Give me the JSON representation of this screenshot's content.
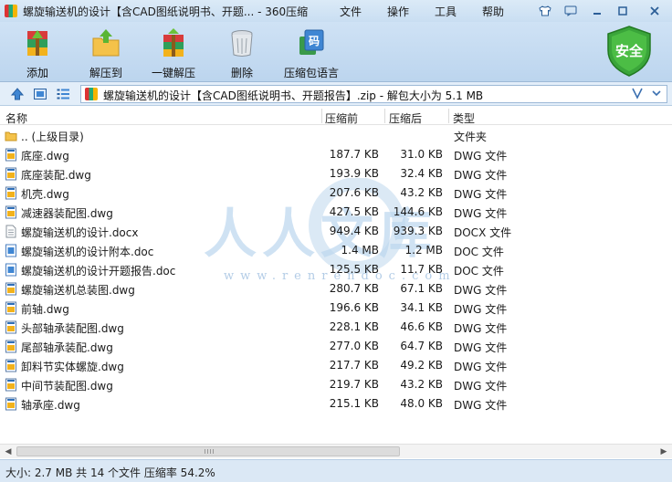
{
  "window": {
    "title": "螺旋输送机的设计【含CAD图纸说明书、开题... - 360压缩",
    "menus": [
      "文件",
      "操作",
      "工具",
      "帮助"
    ]
  },
  "toolbar": {
    "add": "添加",
    "extract_to": "解压到",
    "one_click_extract": "一键解压",
    "delete": "删除",
    "comment": "压缩包语言"
  },
  "security": {
    "label": "安全"
  },
  "address": {
    "path": "螺旋输送机的设计【含CAD图纸说明书、开题报告】.zip - 解包大小为 5.1 MB"
  },
  "columns": {
    "name": "名称",
    "packed": "压缩前",
    "size": "压缩后",
    "type": "类型"
  },
  "files": [
    {
      "name": ".. (上级目录)",
      "packed": "",
      "size": "",
      "type": "文件夹",
      "icon": "folder"
    },
    {
      "name": "底座.dwg",
      "packed": "187.7 KB",
      "size": "31.0 KB",
      "type": "DWG 文件",
      "icon": "dwg"
    },
    {
      "name": "底座装配.dwg",
      "packed": "193.9 KB",
      "size": "32.4 KB",
      "type": "DWG 文件",
      "icon": "dwg"
    },
    {
      "name": "机壳.dwg",
      "packed": "207.6 KB",
      "size": "43.2 KB",
      "type": "DWG 文件",
      "icon": "dwg"
    },
    {
      "name": "减速器装配图.dwg",
      "packed": "427.5 KB",
      "size": "144.6 KB",
      "type": "DWG 文件",
      "icon": "dwg"
    },
    {
      "name": "螺旋输送机的设计.docx",
      "packed": "949.4 KB",
      "size": "939.3 KB",
      "type": "DOCX 文件",
      "icon": "docx"
    },
    {
      "name": "螺旋输送机的设计附本.doc",
      "packed": "1.4 MB",
      "size": "1.2 MB",
      "type": "DOC 文件",
      "icon": "doc"
    },
    {
      "name": "螺旋输送机的设计开题报告.doc",
      "packed": "125.5 KB",
      "size": "11.7 KB",
      "type": "DOC 文件",
      "icon": "doc"
    },
    {
      "name": "螺旋输送机总装图.dwg",
      "packed": "280.7 KB",
      "size": "67.1 KB",
      "type": "DWG 文件",
      "icon": "dwg"
    },
    {
      "name": "前轴.dwg",
      "packed": "196.6 KB",
      "size": "34.1 KB",
      "type": "DWG 文件",
      "icon": "dwg"
    },
    {
      "name": "头部轴承装配图.dwg",
      "packed": "228.1 KB",
      "size": "46.6 KB",
      "type": "DWG 文件",
      "icon": "dwg"
    },
    {
      "name": "尾部轴承装配.dwg",
      "packed": "277.0 KB",
      "size": "64.7 KB",
      "type": "DWG 文件",
      "icon": "dwg"
    },
    {
      "name": "卸料节实体螺旋.dwg",
      "packed": "217.7 KB",
      "size": "49.2 KB",
      "type": "DWG 文件",
      "icon": "dwg"
    },
    {
      "name": "中间节装配图.dwg",
      "packed": "219.7 KB",
      "size": "43.2 KB",
      "type": "DWG 文件",
      "icon": "dwg"
    },
    {
      "name": "轴承座.dwg",
      "packed": "215.1 KB",
      "size": "48.0 KB",
      "type": "DWG 文件",
      "icon": "dwg"
    }
  ],
  "watermark": {
    "text": "人人文库",
    "url": "www.renrendoc.com"
  },
  "status": {
    "text": "大小: 2.7 MB 共 14 个文件 压缩率 54.2%"
  }
}
